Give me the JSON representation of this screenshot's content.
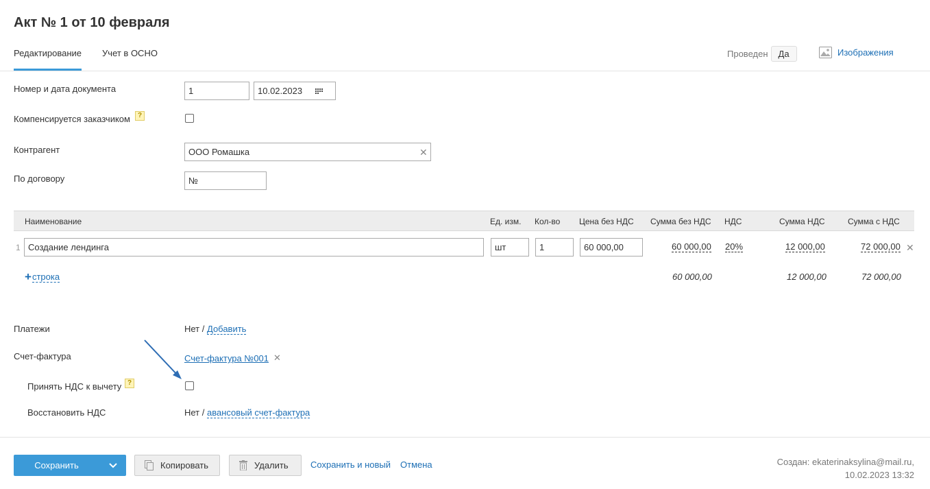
{
  "title": "Акт № 1 от 10 февраля",
  "tabs": [
    {
      "label": "Редактирование"
    },
    {
      "label": "Учет в ОСНО"
    }
  ],
  "posted": {
    "label": "Проведен",
    "value": "Да"
  },
  "images_link": "Изображения",
  "form": {
    "doc_number_label": "Номер и дата документа",
    "doc_number": "1",
    "doc_date": "10.02.2023",
    "compensated_label": "Компенсируется заказчиком",
    "contractor_label": "Контрагент",
    "contractor": "ООО Ромашка",
    "contract_label": "По договору",
    "contract_placeholder": "№"
  },
  "table": {
    "headers": {
      "name": "Наименование",
      "unit": "Ед. изм.",
      "qty": "Кол-во",
      "price": "Цена без НДС",
      "sum_no_vat": "Сумма без НДС",
      "vat": "НДС",
      "vat_sum": "Сумма НДС",
      "sum_with_vat": "Сумма с НДС"
    },
    "rows": [
      {
        "index": "1",
        "name": "Создание лендинга",
        "unit": "шт",
        "qty": "1",
        "price": "60 000,00",
        "sum_no_vat": "60 000,00",
        "vat": "20%",
        "vat_sum": "12 000,00",
        "sum_with_vat": "72 000,00"
      }
    ],
    "add_row_label": "строка",
    "totals": {
      "sum_no_vat": "60 000,00",
      "vat_sum": "12 000,00",
      "sum_with_vat": "72 000,00"
    }
  },
  "payments": {
    "label": "Платежи",
    "value": "Нет /",
    "link": "Добавить"
  },
  "invoice": {
    "label": "Счет-фактура",
    "link": "Счет-фактура №001"
  },
  "vat_deduct": {
    "label": "Принять НДС к вычету"
  },
  "vat_restore": {
    "label": "Восстановить НДС",
    "value": "Нет /",
    "link": "авансовый счет-фактура"
  },
  "footer": {
    "save": "Сохранить",
    "copy": "Копировать",
    "delete": "Удалить",
    "save_new": "Сохранить и новый",
    "cancel": "Отмена",
    "created_line1": "Создан: ekaterinaksylina@mail.ru,",
    "created_line2": "10.02.2023 13:32"
  },
  "colors": {
    "accent": "#3b9ad8",
    "link": "#1d6fb5",
    "arrow": "#2e6db4"
  }
}
